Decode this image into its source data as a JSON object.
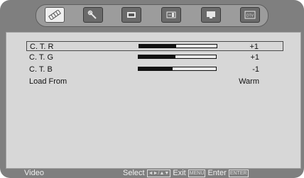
{
  "tabs": [
    {
      "name": "picture-tab",
      "icon": "picture-icon",
      "active": true
    },
    {
      "name": "setup-tab",
      "icon": "wrench-icon",
      "active": false
    },
    {
      "name": "channel-tab",
      "icon": "tv-icon",
      "active": false
    },
    {
      "name": "audio-tab",
      "icon": "speaker-icon",
      "active": false
    },
    {
      "name": "display-tab",
      "icon": "monitor-icon",
      "active": false
    },
    {
      "name": "dtv-tab",
      "icon": "dtv-icon",
      "label": "DTV",
      "active": false
    }
  ],
  "rows": [
    {
      "label": "C. T. R",
      "value": "+1",
      "level": 0.48,
      "selected": true
    },
    {
      "label": "C. T. G",
      "value": "+1",
      "level": 0.48,
      "selected": false
    },
    {
      "label": "C. T. B",
      "value": "-1",
      "level": 0.44,
      "selected": false
    },
    {
      "label": "Load From",
      "value": "Warm"
    }
  ],
  "status": {
    "mode": "Video",
    "select_text": "Select",
    "select_keys": "◄►/▲▼",
    "exit_text": "Exit",
    "exit_key": "MENU",
    "enter_text": "Enter",
    "enter_key": "ENTER"
  }
}
